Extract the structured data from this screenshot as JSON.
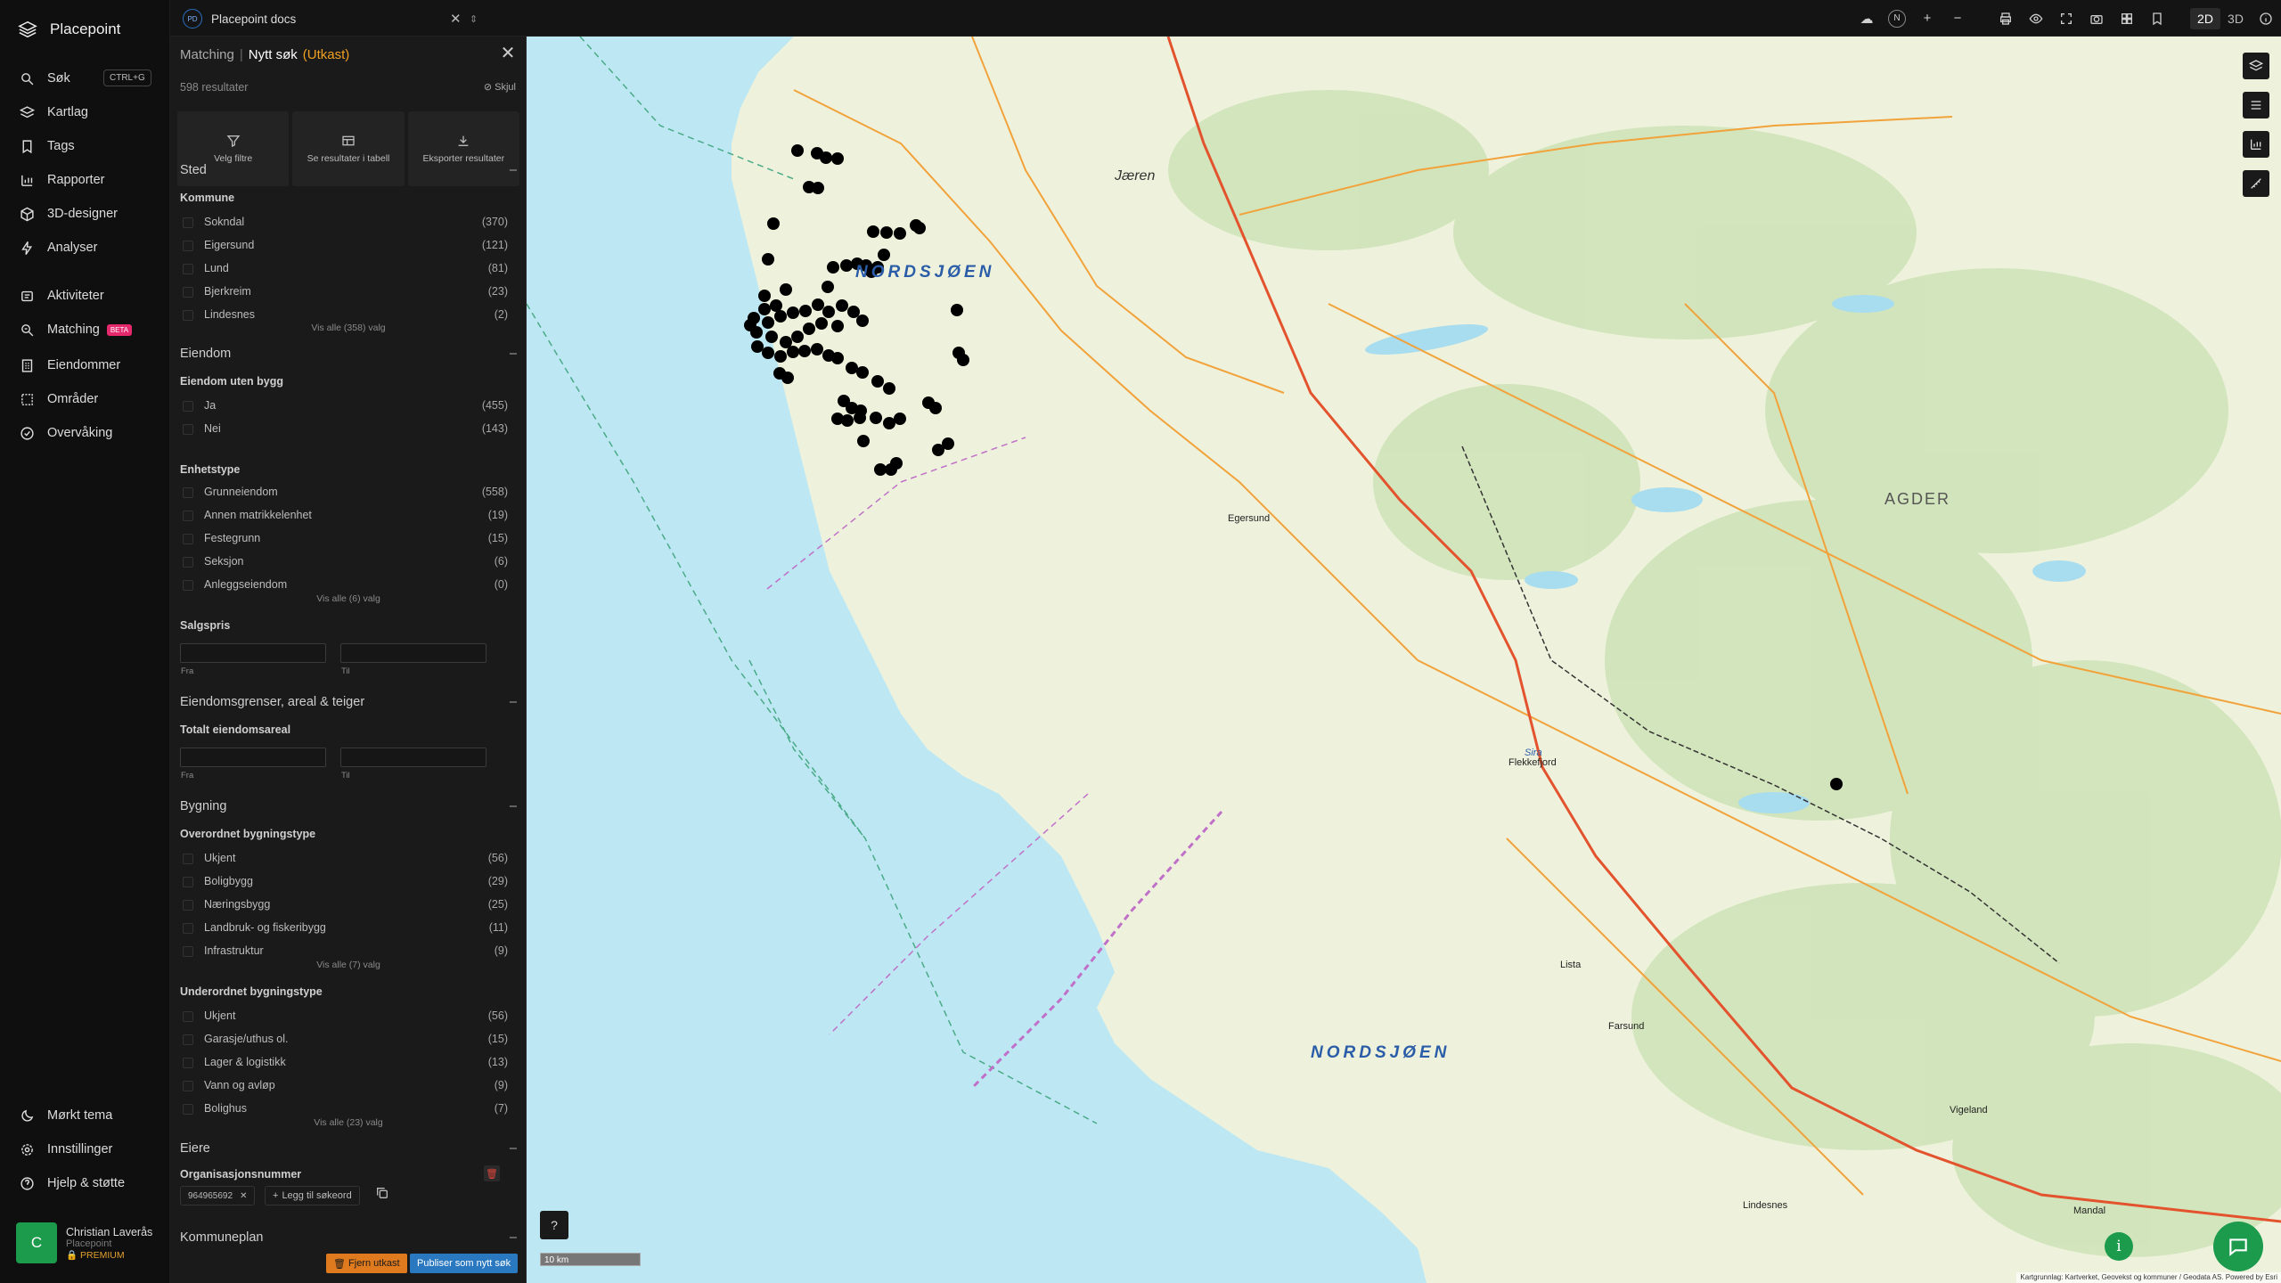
{
  "app": {
    "name": "Placepoint"
  },
  "nav": {
    "items": [
      {
        "label": "Søk",
        "shortcut": "CTRL+G",
        "icon": "search-icon"
      },
      {
        "label": "Kartlag",
        "icon": "layers-icon"
      },
      {
        "label": "Tags",
        "icon": "bookmark-icon"
      },
      {
        "label": "Rapporter",
        "icon": "bar-chart-icon"
      },
      {
        "label": "3D-designer",
        "icon": "cube-icon"
      },
      {
        "label": "Analyser",
        "icon": "bolt-icon"
      },
      {
        "label": "Aktiviteter",
        "icon": "stack-icon"
      },
      {
        "label": "Matching",
        "badge": "BETA",
        "icon": "match-icon"
      },
      {
        "label": "Eiendommer",
        "icon": "building-icon"
      },
      {
        "label": "Områder",
        "icon": "area-icon"
      },
      {
        "label": "Overvåking",
        "icon": "monitor-icon"
      }
    ],
    "bottom": [
      {
        "label": "Mørkt tema",
        "icon": "moon-icon"
      },
      {
        "label": "Innstillinger",
        "icon": "gear-icon"
      },
      {
        "label": "Hjelp & støtte",
        "icon": "help-icon"
      }
    ],
    "user": {
      "initial": "C",
      "name": "Christian Laverås",
      "org": "Placepoint",
      "plan": "PREMIUM"
    }
  },
  "topbar": {
    "badge": "PD",
    "doc_title": "Placepoint docs",
    "mode_2d": "2D",
    "mode_3d": "3D",
    "compass": "N"
  },
  "panel": {
    "crumb": "Matching",
    "title": "Nytt søk",
    "status": "(Utkast)",
    "results": "598 resultater",
    "hide": "Skjul",
    "actions": [
      "Velg filtre",
      "Se resultater i tabell",
      "Eksporter resultater"
    ],
    "sections": {
      "sted": {
        "title": "Sted",
        "sub": "Kommune",
        "options": [
          [
            "Sokndal",
            "(370)"
          ],
          [
            "Eigersund",
            "(121)"
          ],
          [
            "Lund",
            "(81)"
          ],
          [
            "Bjerkreim",
            "(23)"
          ],
          [
            "Lindesnes",
            "(2)"
          ]
        ],
        "more": "Vis alle (358) valg"
      },
      "eiendom": {
        "title": "Eiendom",
        "sub1": "Eiendom uten bygg",
        "opts1": [
          [
            "Ja",
            "(455)"
          ],
          [
            "Nei",
            "(143)"
          ]
        ],
        "sub2": "Enhetstype",
        "opts2": [
          [
            "Grunneiendom",
            "(558)"
          ],
          [
            "Annen matrikkelenhet",
            "(19)"
          ],
          [
            "Festegrunn",
            "(15)"
          ],
          [
            "Seksjon",
            "(6)"
          ],
          [
            "Anleggseiendom",
            "(0)"
          ]
        ],
        "more": "Vis alle (6) valg",
        "sub3": "Salgspris",
        "from": "Fra",
        "to": "Til"
      },
      "grenser": {
        "title": "Eiendomsgrenser, areal & teiger",
        "sub": "Totalt eiendomsareal",
        "from": "Fra",
        "to": "Til"
      },
      "bygning": {
        "title": "Bygning",
        "sub1": "Overordnet bygningstype",
        "opts1": [
          [
            "Ukjent",
            "(56)"
          ],
          [
            "Boligbygg",
            "(29)"
          ],
          [
            "Næringsbygg",
            "(25)"
          ],
          [
            "Landbruk- og fiskeribygg",
            "(11)"
          ],
          [
            "Infrastruktur",
            "(9)"
          ]
        ],
        "more1": "Vis alle (7) valg",
        "sub2": "Underordnet bygningstype",
        "opts2": [
          [
            "Ukjent",
            "(56)"
          ],
          [
            "Garasje/uthus ol.",
            "(15)"
          ],
          [
            "Lager & logistikk",
            "(13)"
          ],
          [
            "Vann og avløp",
            "(9)"
          ],
          [
            "Bolighus",
            "(7)"
          ]
        ],
        "more2": "Vis alle (23) valg"
      },
      "eiere": {
        "title": "Eiere",
        "sub": "Organisasjonsnummer",
        "tag": "964965692",
        "add": "Legg til søkeord"
      },
      "kommuneplan": {
        "title": "Kommuneplan"
      }
    },
    "buttons": {
      "remove": "Fjern utkast",
      "publish": "Publiser som nytt søk"
    }
  },
  "map": {
    "labels": [
      "NORDSJØEN",
      "NORDSJØEN",
      "AGDER",
      "Jæren",
      "Egersund",
      "Flekkefjord",
      "Farsund",
      "Mandal",
      "Lindesnes",
      "Vigeland",
      "Lista",
      "Sira"
    ],
    "scale": "10 km",
    "attribution": "Kartgrunnlag: Kartverket, Geovekst og kommuner / Geodata AS. Powered by Esri",
    "colors": {
      "sea": "#bde8f3",
      "land": "#eef2dc",
      "forest": "#cfe3b8",
      "road": "#f2a23a",
      "main_road": "#e2532e",
      "point": "#000000"
    }
  }
}
